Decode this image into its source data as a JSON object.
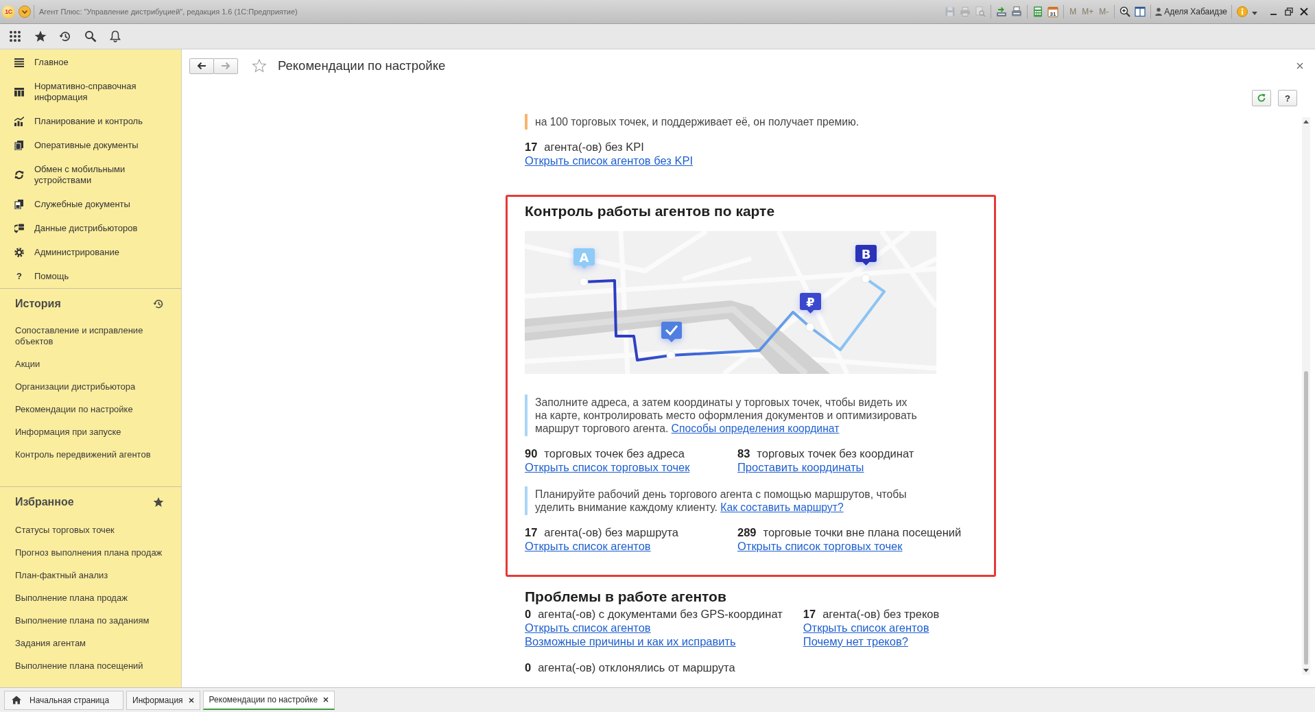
{
  "title_bar": {
    "logo": "1С",
    "title": "Агент Плюс: \"Управление дистрибуцией\", редакция 1.6 (1С:Предприятие)",
    "tools": [
      {
        "kind": "save",
        "disabled": true
      },
      {
        "kind": "print",
        "disabled": true
      },
      {
        "kind": "preview",
        "disabled": true
      },
      {
        "kind": "upload",
        "disabled": false
      },
      {
        "kind": "scanner",
        "disabled": false
      },
      {
        "kind": "calculator",
        "disabled": false
      },
      {
        "kind": "calendar",
        "label": "31",
        "disabled": false
      },
      {
        "kind": "memory",
        "label": "M",
        "disabled": true
      },
      {
        "kind": "memory",
        "label": "M+",
        "disabled": true
      },
      {
        "kind": "memory",
        "label": "M-",
        "disabled": true
      },
      {
        "kind": "zoom",
        "disabled": false
      },
      {
        "kind": "panel",
        "disabled": false
      }
    ],
    "user": "Аделя Хабаидзе"
  },
  "sidebar": {
    "sections": [
      {
        "label": "Главное"
      },
      {
        "label": "Нормативно-справочная информация"
      },
      {
        "label": "Планирование и контроль"
      },
      {
        "label": "Оперативные документы"
      },
      {
        "label": "Обмен с мобильными устройствами"
      },
      {
        "label": "Служебные документы"
      },
      {
        "label": "Данные дистрибьюторов"
      },
      {
        "label": "Администрирование"
      },
      {
        "label": "Помощь",
        "glyph": "?"
      }
    ],
    "history": {
      "title": "История",
      "items": [
        "Сопоставление и исправление объектов",
        "Акции",
        "Организации дистрибьютора",
        "Рекомендации по настройке",
        "Информация при запуске",
        "Контроль передвижений агентов"
      ]
    },
    "favorites": {
      "title": "Избранное",
      "items": [
        "Статусы торговых точек",
        "Прогноз выполнения плана продаж",
        "План-фактный анализ",
        "Выполнение плана продаж",
        "Выполнение плана по заданиям",
        "Задания агентам",
        "Выполнение плана посещений"
      ]
    }
  },
  "page": {
    "nav": [
      {
        "kind": "back",
        "disabled": false
      },
      {
        "kind": "forward",
        "disabled": true
      }
    ],
    "favorite": false,
    "title": "Рекомендации по настройке",
    "help_button": "?",
    "sections": [
      {
        "highlighted": false,
        "groups": [
          {
            "note": {
              "text": "на 100 торговых точек, и поддерживает её, он получает премию.",
              "color": "#f8b46c"
            },
            "stats": [
              {
                "count": "17",
                "text": "агента(-ов) без KPI",
                "links": [
                  "Открыть список агентов без KPI"
                ]
              }
            ]
          }
        ]
      },
      {
        "title": "Контроль работы агентов по карте",
        "highlighted": true,
        "map": {
          "markers": [
            {
              "label": "A",
              "color": "#8ecbf6"
            },
            {
              "label": "₽",
              "color": "#3a46cc"
            },
            {
              "label": "B",
              "color": "#2b32b8"
            }
          ]
        },
        "groups": [
          {
            "note": {
              "text": "Заполните адреса, а затем координаты у торговых точек, чтобы видеть их на карте, контролировать место оформления документов и оптимизировать маршрут торгового агента.",
              "link": "Способы определения координат",
              "color": "#a9d5f5"
            },
            "stats": [
              {
                "count": "90",
                "text": "торговых точек без адреса",
                "links": [
                  "Открыть список торговых точек"
                ]
              },
              {
                "count": "83",
                "text": "торговых точек без координат",
                "links": [
                  "Проставить координаты"
                ]
              }
            ]
          },
          {
            "note": {
              "text": "Планируйте рабочий день торгового агента с помощью маршрутов, чтобы уделить внимание каждому клиенту.",
              "link": "Как составить маршрут?",
              "color": "#a9d5f5"
            },
            "stats": [
              {
                "count": "17",
                "text": "агента(-ов) без маршрута",
                "links": [
                  "Открыть список агентов"
                ]
              },
              {
                "count": "289",
                "text": "торговые точки вне плана посещений",
                "links": [
                  "Открыть список торговых точек"
                ]
              }
            ]
          }
        ]
      },
      {
        "title": "Проблемы в работе агентов",
        "highlighted": false,
        "groups": [
          {
            "stats": [
              {
                "count": "0",
                "text": "агента(-ов) с документами без GPS-координат",
                "links": [
                  "Открыть список агентов",
                  "Возможные причины и как их исправить"
                ]
              },
              {
                "count": "17",
                "text": "агента(-ов) без треков",
                "links": [
                  "Открыть список агентов",
                  "Почему нет треков?"
                ]
              }
            ]
          },
          {
            "stats": [
              {
                "count": "0",
                "text": "агента(-ов) отклонялись от маршрута"
              }
            ]
          }
        ]
      }
    ]
  },
  "tabs": [
    {
      "label": "Начальная страница",
      "kind": "home",
      "selected": false
    },
    {
      "label": "Информация",
      "kind": "page",
      "selected": false
    },
    {
      "label": "Рекомендации по настройке",
      "kind": "page",
      "selected": true
    }
  ]
}
